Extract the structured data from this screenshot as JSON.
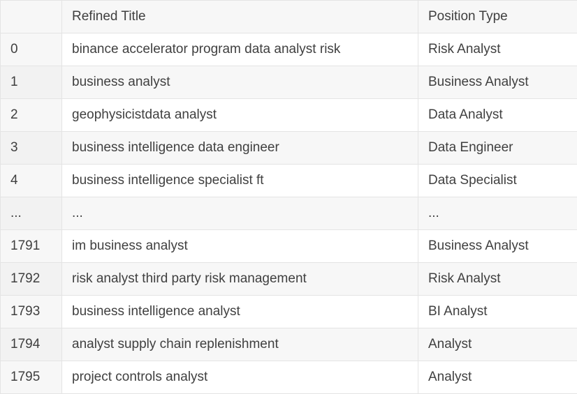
{
  "table": {
    "columns": {
      "index_header": "",
      "refined_title": "Refined Title",
      "position_type": "Position Type"
    },
    "rows": [
      {
        "idx": "0",
        "refined_title": "binance accelerator program data analyst risk",
        "position_type": "Risk Analyst"
      },
      {
        "idx": "1",
        "refined_title": "business analyst",
        "position_type": "Business Analyst"
      },
      {
        "idx": "2",
        "refined_title": "geophysicistdata analyst",
        "position_type": "Data Analyst"
      },
      {
        "idx": "3",
        "refined_title": "business intelligence data engineer",
        "position_type": "Data Engineer"
      },
      {
        "idx": "4",
        "refined_title": "business intelligence specialist ft",
        "position_type": "Data Specialist"
      },
      {
        "idx": "...",
        "refined_title": "...",
        "position_type": "..."
      },
      {
        "idx": "1791",
        "refined_title": "im business analyst",
        "position_type": "Business Analyst"
      },
      {
        "idx": "1792",
        "refined_title": "risk analyst third party risk management",
        "position_type": "Risk Analyst"
      },
      {
        "idx": "1793",
        "refined_title": "business intelligence analyst",
        "position_type": "BI Analyst"
      },
      {
        "idx": "1794",
        "refined_title": "analyst supply chain replenishment",
        "position_type": "Analyst"
      },
      {
        "idx": "1795",
        "refined_title": "project controls analyst",
        "position_type": "Analyst"
      }
    ]
  }
}
